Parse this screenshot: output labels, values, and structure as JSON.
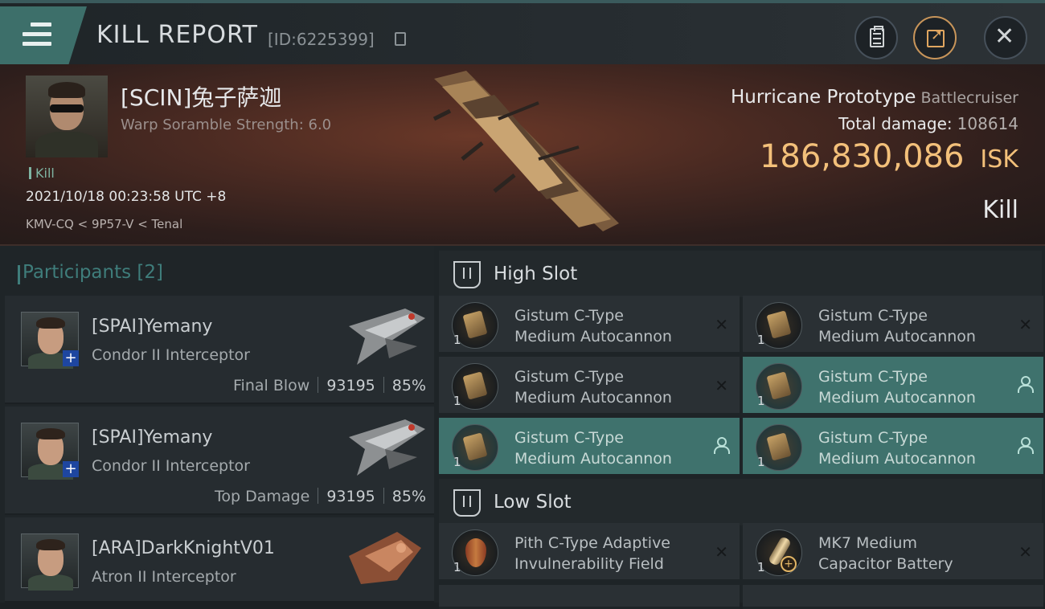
{
  "header": {
    "title": "KILL REPORT",
    "report_id": "[ID:6225399]"
  },
  "victim": {
    "name": "[SCIN]兔子萨迦",
    "warp_scramble": "Warp Soramble Strength: 6.0",
    "tag": "Kill",
    "datetime": "2021/10/18 00:23:58 UTC +8",
    "location": "KMV-CQ < 9P57-V < Tenal",
    "ship_name": "Hurricane Prototype",
    "ship_class": "Battlecruiser",
    "total_damage_label": "Total damage:",
    "total_damage": "108614",
    "isk_value": "186,830,086",
    "isk_unit": "ISK",
    "result": "Kill"
  },
  "participants": {
    "title": "Participants",
    "count": "[2]",
    "items": [
      {
        "name": "[SPAI]Yemany",
        "ship": "Condor II Interceptor",
        "role": "Final Blow",
        "damage": "93195",
        "percent": "85%"
      },
      {
        "name": "[SPAI]Yemany",
        "ship": "Condor II Interceptor",
        "role": "Top Damage",
        "damage": "93195",
        "percent": "85%"
      },
      {
        "name": "[ARA]DarkKnightV01",
        "ship": "Atron II Interceptor"
      }
    ]
  },
  "slots": {
    "high": {
      "label": "High Slot",
      "modules": [
        {
          "line1": "Gistum C-Type",
          "line2": "Medium Autocannon",
          "qty": "1",
          "state": "destroyed"
        },
        {
          "line1": "Gistum C-Type",
          "line2": "Medium Autocannon",
          "qty": "1",
          "state": "destroyed"
        },
        {
          "line1": "Gistum C-Type",
          "line2": "Medium Autocannon",
          "qty": "1",
          "state": "destroyed"
        },
        {
          "line1": "Gistum C-Type",
          "line2": "Medium Autocannon",
          "qty": "1",
          "state": "dropped"
        },
        {
          "line1": "Gistum C-Type",
          "line2": "Medium Autocannon",
          "qty": "1",
          "state": "dropped"
        },
        {
          "line1": "Gistum C-Type",
          "line2": "Medium Autocannon",
          "qty": "1",
          "state": "dropped"
        }
      ]
    },
    "low": {
      "label": "Low Slot",
      "modules": [
        {
          "line1": "Pith C-Type Adaptive",
          "line2": "Invulnerability Field",
          "qty": "1",
          "state": "destroyed"
        },
        {
          "line1": "MK7 Medium",
          "line2": "Capacitor Battery",
          "qty": "1",
          "state": "destroyed"
        }
      ]
    }
  },
  "colors": {
    "accent": "#3f726d",
    "isk": "#f3c07a",
    "participants_title": "#3f7d7b"
  },
  "icons": [
    "menu-icon",
    "copy-icon",
    "clipboard-icon",
    "share-icon",
    "close-icon",
    "high-slot-icon",
    "low-slot-icon",
    "user-icon"
  ]
}
